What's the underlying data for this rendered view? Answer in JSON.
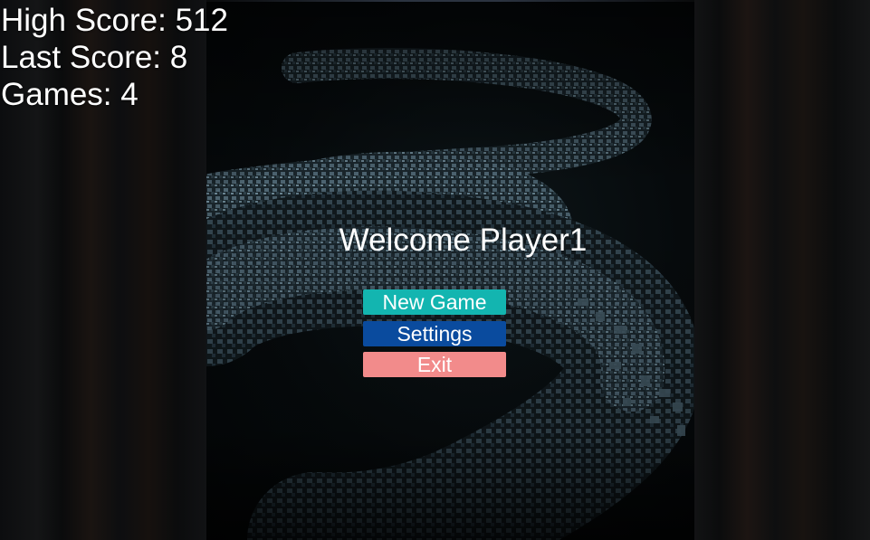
{
  "hud": {
    "high_score": "High Score: 512",
    "last_score": "Last Score: 8",
    "games": "Games: 4"
  },
  "menu": {
    "welcome": "Welcome Player1",
    "new_game_label": "New Game",
    "settings_label": "Settings",
    "exit_label": "Exit"
  },
  "colors": {
    "new_game_button": "#13b5b0",
    "settings_button": "#0a4b9e",
    "exit_button": "#f28b8b",
    "text": "#ffffff",
    "serpent": "#4a6270"
  },
  "background": {
    "image": "pixelated-serpent-artwork"
  }
}
